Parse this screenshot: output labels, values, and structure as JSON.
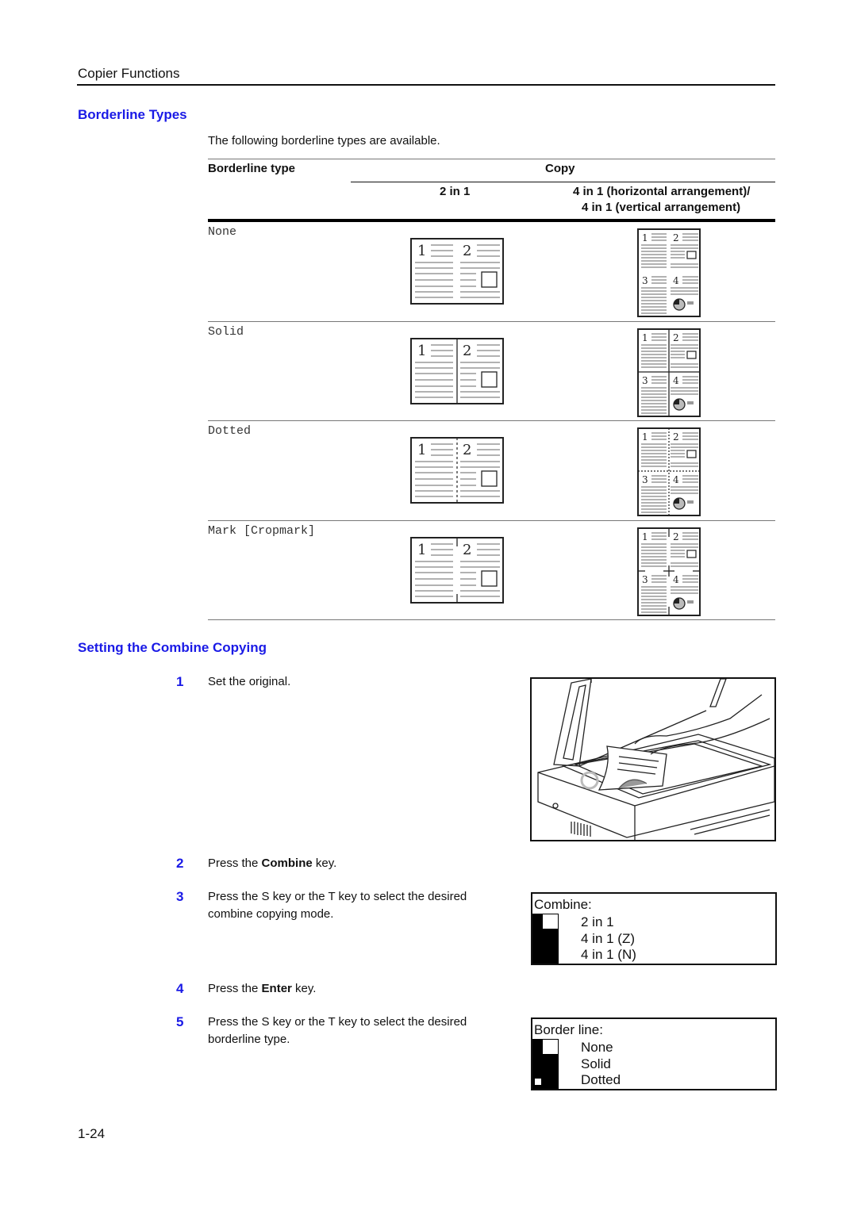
{
  "header": {
    "section": "Copier Functions"
  },
  "borderline_section": {
    "title": "Borderline Types",
    "intro": "The following borderline types are available.",
    "table": {
      "col_type": "Borderline type",
      "col_copy": "Copy",
      "col_2in1": "2 in 1",
      "col_4in1_line1": "4 in 1 (horizontal arrangement)/",
      "col_4in1_line2": "4 in 1 (vertical arrangement)",
      "rows": [
        {
          "label": "None",
          "style": "none"
        },
        {
          "label": "Solid",
          "style": "solid"
        },
        {
          "label": "Dotted",
          "style": "dotted"
        },
        {
          "label": "Mark [Cropmark]",
          "style": "mark"
        }
      ]
    }
  },
  "setting_section": {
    "title": "Setting the Combine Copying",
    "steps": [
      {
        "num": "1",
        "text": "Set the original."
      },
      {
        "num": "2",
        "pre": "Press the ",
        "bold": "Combine",
        "post": " key."
      },
      {
        "num": "3",
        "text": "Press the  S key or the  T key to select the desired combine copying mode."
      },
      {
        "num": "4",
        "pre": "Press the ",
        "bold": "Enter",
        "post": " key."
      },
      {
        "num": "5",
        "text": "Press the  S key or the  T key to select the desired borderline type."
      }
    ]
  },
  "lcd_combine": {
    "title": "Combine:",
    "options": [
      "2 in 1",
      "4 in 1 (Z)",
      "4 in 1 (N)"
    ],
    "selected": "2 in 1"
  },
  "lcd_border": {
    "title": "Border line:",
    "options": [
      "None",
      "Solid",
      "Dotted"
    ],
    "selected": "None"
  },
  "page_number": "1-24"
}
